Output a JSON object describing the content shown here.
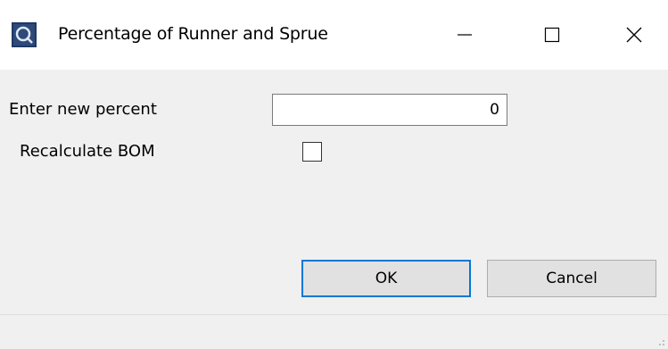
{
  "window": {
    "title": "Percentage of Runner and Sprue",
    "app_icon": "app-logo-icon",
    "controls": {
      "minimize_icon": "minimize-icon",
      "maximize_icon": "maximize-icon",
      "close_icon": "close-icon"
    }
  },
  "form": {
    "percent_label": "Enter new percent",
    "percent_value": "0",
    "recalc_label": "Recalculate BOM",
    "recalc_checked": false
  },
  "buttons": {
    "ok_label": "OK",
    "cancel_label": "Cancel"
  },
  "colors": {
    "accent": "#0078d7",
    "icon_bg": "#1f3864"
  }
}
